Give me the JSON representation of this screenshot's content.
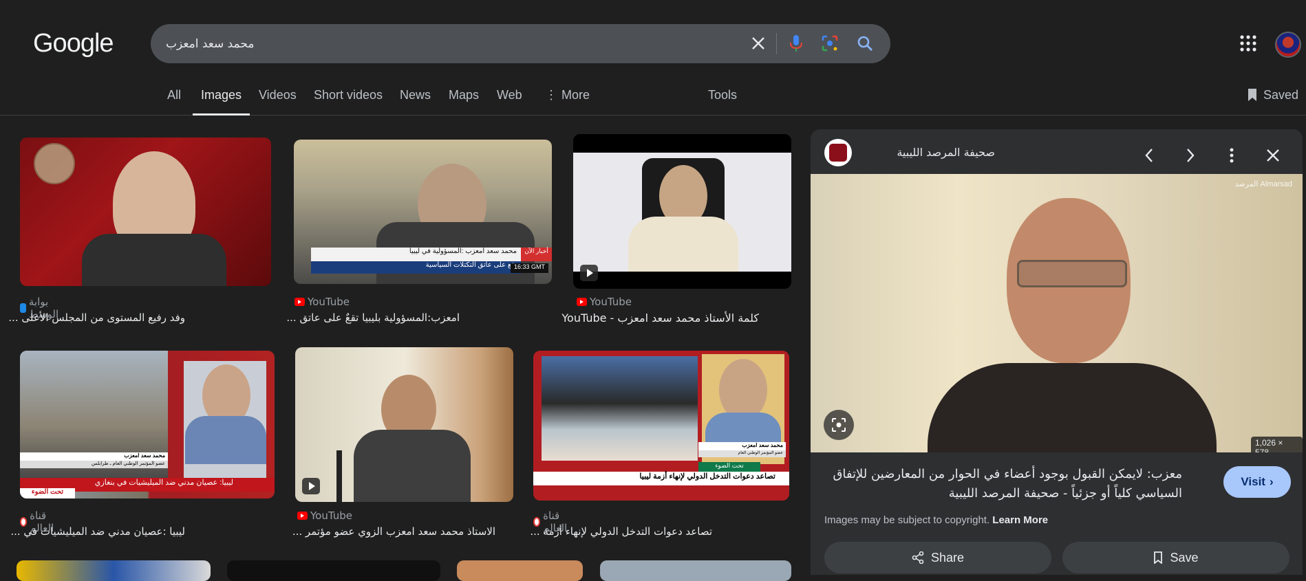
{
  "app": {
    "logo": "Google"
  },
  "search": {
    "query": "محمد سعد امعزب",
    "clear_icon": "close-icon",
    "mic_icon": "mic-icon",
    "lens_icon": "lens-icon",
    "search_icon": "search-icon"
  },
  "tabs": [
    {
      "label": "All"
    },
    {
      "label": "Images",
      "active": true
    },
    {
      "label": "Videos"
    },
    {
      "label": "Short videos"
    },
    {
      "label": "News"
    },
    {
      "label": "Maps"
    },
    {
      "label": "Web"
    },
    {
      "label": "More"
    }
  ],
  "tools_label": "Tools",
  "saved_label": "Saved",
  "results": [
    {
      "source": "بوابة الوسط",
      "title": "وفد رفيع المستوى من المجلس الأعلى ..."
    },
    {
      "source": "YouTube",
      "title": "امعزب:المسؤولية بليبيا تقعٌ على عاتق ..."
    },
    {
      "source": "YouTube",
      "title": "كلمة الأستاذ محمد سعد امعزب - YouTube"
    },
    {
      "source": "قناة العالم",
      "title": "ليبيا :عصيان مدني ضد الميليشيات في ..."
    },
    {
      "source": "YouTube",
      "title": "الاستاذ محمد سعد امعزب الزوي عضو مؤتمر ..."
    },
    {
      "source": "قناة العالم",
      "title": "تصاعد دعوات التدخل الدولي لإنهاء أزمة ..."
    }
  ],
  "thumb_text": {
    "r2_ticker1": "محمد سعد امعزب :المسؤولية في ليبيا",
    "r2_ticker2": "تقع على عاتق التكتلات السياسية",
    "r2_brand": "أخبار الآن",
    "r2_time": "16:33 GMT",
    "r4_name": "محمد سعد امعزب",
    "r4_role": "عضو المؤتمر الوطني العام ـ طرابلس",
    "r4_ticker": "ليبيا: عصيان مدني ضد الميليشيات في بنغازي",
    "r4_show": "تحت الضوء",
    "r6_name": "محمد سعد امعزب",
    "r6_role": "عضو المؤتمر الوطني العام",
    "r6_show": "تحت الضوء",
    "r6_ticker": "تصاعد دعوات التدخل الدولي لإنهاء أزمة ليبيا"
  },
  "panel": {
    "site": "صحيفة المرصد الليبية",
    "watermark": "المرصد Almarsad",
    "dimensions": "1,026 × 578",
    "title": "معزب: لايمكن القبول بوجود أعضاء في الحوار من المعارضين للإتفاق السياسي كلياً أو جزئياً - صحيفة المرصد الليبية",
    "copyright": "Images may be subject to copyright.",
    "learn_more": "Learn More",
    "visit_label": "Visit",
    "share_label": "Share",
    "save_label": "Save"
  },
  "colors": {
    "background": "#1f1f1f",
    "accent": "#a8c7fa",
    "youtube": "#ff0000"
  }
}
